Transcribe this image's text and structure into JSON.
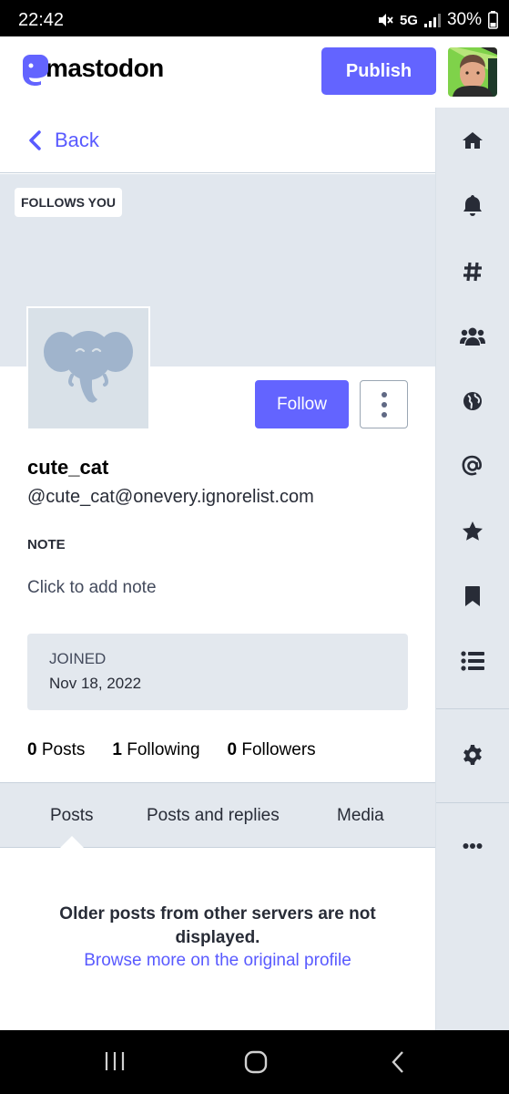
{
  "status_bar": {
    "time": "22:42",
    "network": "5G",
    "battery": "30%"
  },
  "header": {
    "logo_text": "mastodon",
    "publish_label": "Publish"
  },
  "back_label": "Back",
  "profile": {
    "follows_you_badge": "FOLLOWS YOU",
    "display_name": "cute_cat",
    "handle": "@cute_cat@onevery.ignorelist.com",
    "follow_label": "Follow",
    "note_label": "NOTE",
    "note_placeholder": "Click to add note",
    "joined_label": "JOINED",
    "joined_date": "Nov 18, 2022",
    "counts": {
      "posts_count": "0",
      "posts_label": "Posts",
      "following_count": "1",
      "following_label": "Following",
      "followers_count": "0",
      "followers_label": "Followers"
    }
  },
  "tabs": {
    "posts": "Posts",
    "posts_and_replies": "Posts and replies",
    "media": "Media"
  },
  "empty_state": {
    "message": "Older posts from other servers are not displayed.",
    "link": "Browse more on the original profile"
  },
  "rail_icons": [
    "home-icon",
    "bell-icon",
    "hashtag-icon",
    "users-icon",
    "globe-icon",
    "at-icon",
    "star-icon",
    "bookmark-icon",
    "list-icon",
    "gear-icon",
    "ellipsis-icon"
  ],
  "colors": {
    "accent": "#6364ff",
    "link": "#595aff",
    "rail_bg": "#e3e8ee",
    "banner_bg": "#e1e7ee"
  }
}
